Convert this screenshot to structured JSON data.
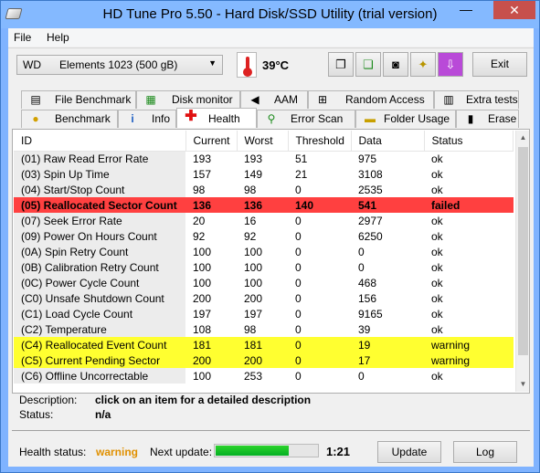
{
  "window": {
    "title": "HD Tune Pro 5.50 - Hard Disk/SSD Utility (trial version)",
    "minimize_glyph": "—",
    "close_glyph": "✕"
  },
  "menu": {
    "file": "File",
    "help": "Help"
  },
  "toolbar": {
    "drive": "WD      Elements 1023 (500 gB)",
    "temperature": "39°C",
    "exit_label": "Exit",
    "icons": [
      "copy-icon",
      "copy-all-icon",
      "camera-icon",
      "options-icon",
      "download-icon"
    ]
  },
  "tabs": {
    "row1": [
      {
        "label": "File Benchmark",
        "icon": "file-benchmark-icon"
      },
      {
        "label": "Disk monitor",
        "icon": "disk-monitor-icon"
      },
      {
        "label": "AAM",
        "icon": "speaker-icon"
      },
      {
        "label": "Random Access",
        "icon": "random-access-icon"
      },
      {
        "label": "Extra tests",
        "icon": "extra-tests-icon"
      }
    ],
    "row2": [
      {
        "label": "Benchmark",
        "icon": "bulb-icon"
      },
      {
        "label": "Info",
        "icon": "info-icon"
      },
      {
        "label": "Health",
        "icon": "red-cross-icon",
        "active": true
      },
      {
        "label": "Error Scan",
        "icon": "magnifier-icon"
      },
      {
        "label": "Folder Usage",
        "icon": "folder-icon"
      },
      {
        "label": "Erase",
        "icon": "trash-icon"
      }
    ]
  },
  "table": {
    "columns": [
      "ID",
      "Current",
      "Worst",
      "Threshold",
      "Data",
      "Status"
    ],
    "rows": [
      {
        "id": "(01) Raw Read Error Rate",
        "current": "193",
        "worst": "193",
        "threshold": "51",
        "data": "975",
        "status": "ok",
        "state": "ok"
      },
      {
        "id": "(03) Spin Up Time",
        "current": "157",
        "worst": "149",
        "threshold": "21",
        "data": "3108",
        "status": "ok",
        "state": "ok"
      },
      {
        "id": "(04) Start/Stop Count",
        "current": "98",
        "worst": "98",
        "threshold": "0",
        "data": "2535",
        "status": "ok",
        "state": "ok"
      },
      {
        "id": "(05) Reallocated Sector Count",
        "current": "136",
        "worst": "136",
        "threshold": "140",
        "data": "541",
        "status": "failed",
        "state": "failed"
      },
      {
        "id": "(07) Seek Error Rate",
        "current": "20",
        "worst": "16",
        "threshold": "0",
        "data": "2977",
        "status": "ok",
        "state": "ok"
      },
      {
        "id": "(09) Power On Hours Count",
        "current": "92",
        "worst": "92",
        "threshold": "0",
        "data": "6250",
        "status": "ok",
        "state": "ok"
      },
      {
        "id": "(0A) Spin Retry Count",
        "current": "100",
        "worst": "100",
        "threshold": "0",
        "data": "0",
        "status": "ok",
        "state": "ok"
      },
      {
        "id": "(0B) Calibration Retry Count",
        "current": "100",
        "worst": "100",
        "threshold": "0",
        "data": "0",
        "status": "ok",
        "state": "ok"
      },
      {
        "id": "(0C) Power Cycle Count",
        "current": "100",
        "worst": "100",
        "threshold": "0",
        "data": "468",
        "status": "ok",
        "state": "ok"
      },
      {
        "id": "(C0) Unsafe Shutdown Count",
        "current": "200",
        "worst": "200",
        "threshold": "0",
        "data": "156",
        "status": "ok",
        "state": "ok"
      },
      {
        "id": "(C1) Load Cycle Count",
        "current": "197",
        "worst": "197",
        "threshold": "0",
        "data": "9165",
        "status": "ok",
        "state": "ok"
      },
      {
        "id": "(C2) Temperature",
        "current": "108",
        "worst": "98",
        "threshold": "0",
        "data": "39",
        "status": "ok",
        "state": "ok"
      },
      {
        "id": "(C4) Reallocated Event Count",
        "current": "181",
        "worst": "181",
        "threshold": "0",
        "data": "19",
        "status": "warning",
        "state": "warning"
      },
      {
        "id": "(C5) Current Pending Sector",
        "current": "200",
        "worst": "200",
        "threshold": "0",
        "data": "17",
        "status": "warning",
        "state": "warning"
      },
      {
        "id": "(C6) Offline Uncorrectable",
        "current": "100",
        "worst": "253",
        "threshold": "0",
        "data": "0",
        "status": "ok",
        "state": "ok"
      }
    ]
  },
  "description": {
    "desc_label": "Description:",
    "desc_value": "click on an item for a detailed description",
    "status_label": "Status:",
    "status_value": "n/a"
  },
  "footer": {
    "health_label": "Health status:",
    "health_value": "warning",
    "next_update_label": "Next update:",
    "next_update_time": "1:21",
    "next_update_progress": 0.72,
    "update_label": "Update",
    "log_label": "Log"
  },
  "colors": {
    "failed_row": "#ff4040",
    "warning_row": "#ffff30",
    "health_warning_text": "#e09000",
    "progress_fill": "#06b025"
  }
}
